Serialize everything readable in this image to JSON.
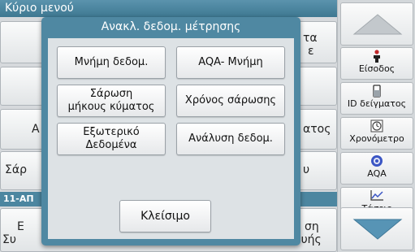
{
  "background": {
    "title": "Κύριο μενού",
    "tiles": [
      "τα",
      "ε",
      "Α",
      "ατος",
      "Σάρ",
      "υ",
      "Ε",
      "ση",
      "Συ",
      "ευής"
    ],
    "stripe": "11-ΑΠ"
  },
  "dialog": {
    "title": "Ανακλ. δεδομ. μέτρησης",
    "buttons": {
      "data_memory": "Μνήμη δεδομ.",
      "aqa_memory": "AQA- Μνήμη",
      "wavelength_scan": "Σάρωση\nμήκους κύματος",
      "time_scan": "Χρόνος σάρωσης",
      "external_data": "Εξωτερικό\nΔεδομένα",
      "data_analysis": "Ανάλυση δεδομ."
    },
    "close": "Κλείσιμο"
  },
  "sidebar": {
    "login": "Είσοδος",
    "sample_id": "ID δείγματος",
    "timer": "Χρονόμετρο",
    "aqa": "AQA",
    "trends": "Τάσεις"
  },
  "colors": {
    "accent": "#4f88a2",
    "title_bar": "#3e7891",
    "sidebar": "#d3d7da"
  }
}
